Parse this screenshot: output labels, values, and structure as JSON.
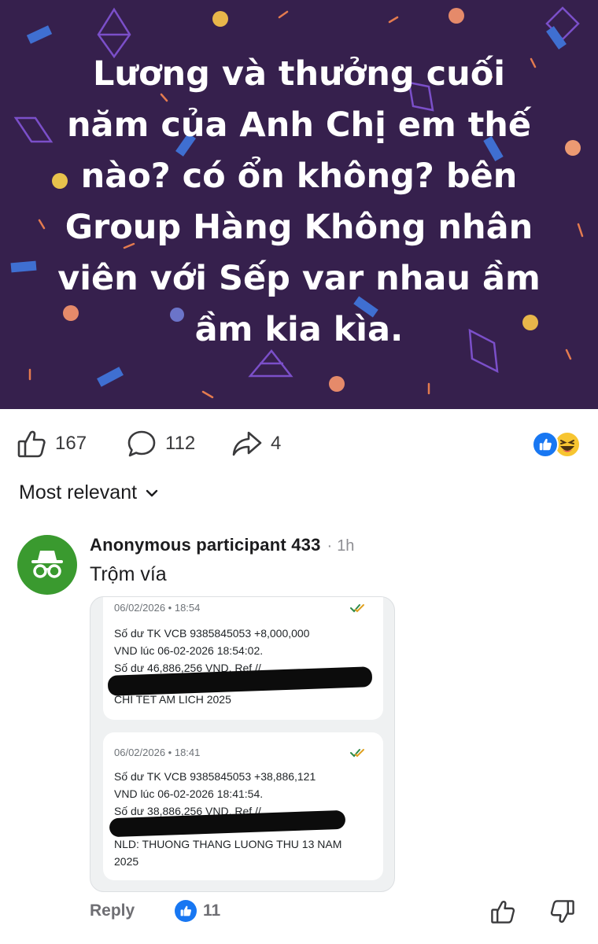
{
  "post": {
    "banner_lines": [
      "Lương và thưởng cuối",
      "năm của Anh Chị em thế",
      "nào? có ổn không? bên",
      "Group Hàng Không nhân",
      "viên với Sếp var nhau ầm",
      "ầm kia kìa."
    ],
    "banner_bg": "#36204d"
  },
  "actions": {
    "likes": "167",
    "comments": "112",
    "shares": "4",
    "reactions": [
      "like",
      "haha"
    ]
  },
  "sort": {
    "label": "Most relevant"
  },
  "comment": {
    "author": "Anonymous participant 433",
    "separator": "·",
    "time": "1h",
    "text": "Trộm vía",
    "attachment": {
      "messages": [
        {
          "timestamp": "06/02/2026 • 18:54",
          "lines": [
            "Số dư TK VCB 9385845053 +8,000,000",
            "VND lúc 06-02-2026 18:54:02.",
            "Số dư 46,886,256 VND. Ref //",
            "CHI TET AM LICH 2025"
          ]
        },
        {
          "timestamp": "06/02/2026 • 18:41",
          "lines": [
            "Số dư TK VCB 9385845053 +38,886,121",
            "VND lúc 06-02-2026 18:41:54.",
            "Số dư 38,886,256 VND. Ref //",
            "NLD: THUONG THANG LUONG THU 13 NAM",
            "2025"
          ]
        }
      ]
    },
    "reply_label": "Reply",
    "like_count": "11"
  }
}
